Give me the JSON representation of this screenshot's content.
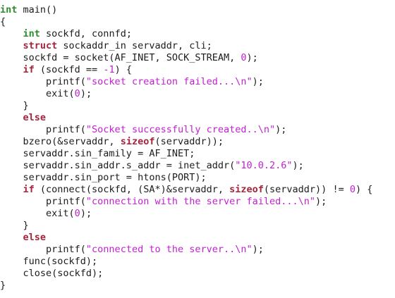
{
  "editor": {
    "colors": {
      "background": "#ffffff",
      "text": "#1c1c1c",
      "type_keyword": "#2e8b2e",
      "control_keyword": "#a5243c",
      "string_literal": "#c21fd0",
      "number_literal": "#c21fd0"
    },
    "lines": [
      [
        {
          "k": "kw-type",
          "t": "int"
        },
        {
          "k": "plain",
          "t": " main()"
        }
      ],
      [
        {
          "k": "plain",
          "t": "{"
        }
      ],
      [
        {
          "k": "plain",
          "t": "    "
        },
        {
          "k": "kw-type",
          "t": "int"
        },
        {
          "k": "plain",
          "t": " sockfd, connfd;"
        }
      ],
      [
        {
          "k": "plain",
          "t": "    "
        },
        {
          "k": "kw-ctrl",
          "t": "struct"
        },
        {
          "k": "plain",
          "t": " sockaddr_in servaddr, cli;"
        }
      ],
      [
        {
          "k": "plain",
          "t": "    sockfd = socket(AF_INET, SOCK_STREAM, "
        },
        {
          "k": "num",
          "t": "0"
        },
        {
          "k": "plain",
          "t": ");"
        }
      ],
      [
        {
          "k": "plain",
          "t": "    "
        },
        {
          "k": "kw-ctrl",
          "t": "if"
        },
        {
          "k": "plain",
          "t": " (sockfd == "
        },
        {
          "k": "num",
          "t": "-1"
        },
        {
          "k": "plain",
          "t": ") {"
        }
      ],
      [
        {
          "k": "plain",
          "t": "        printf("
        },
        {
          "k": "str",
          "t": "\"socket creation failed...\\n\""
        },
        {
          "k": "plain",
          "t": ");"
        }
      ],
      [
        {
          "k": "plain",
          "t": "        exit("
        },
        {
          "k": "num",
          "t": "0"
        },
        {
          "k": "plain",
          "t": ");"
        }
      ],
      [
        {
          "k": "plain",
          "t": "    }"
        }
      ],
      [
        {
          "k": "plain",
          "t": "    "
        },
        {
          "k": "kw-ctrl",
          "t": "else"
        }
      ],
      [
        {
          "k": "plain",
          "t": "        printf("
        },
        {
          "k": "str",
          "t": "\"Socket successfully created..\\n\""
        },
        {
          "k": "plain",
          "t": ");"
        }
      ],
      [
        {
          "k": "plain",
          "t": "    bzero(&servaddr, "
        },
        {
          "k": "kw-ctrl",
          "t": "sizeof"
        },
        {
          "k": "plain",
          "t": "(servaddr));"
        }
      ],
      [
        {
          "k": "plain",
          "t": "    servaddr.sin_family = AF_INET;"
        }
      ],
      [
        {
          "k": "plain",
          "t": "    servaddr.sin_addr.s_addr = inet_addr("
        },
        {
          "k": "str",
          "t": "\"10.0.2.6\""
        },
        {
          "k": "plain",
          "t": ");"
        }
      ],
      [
        {
          "k": "plain",
          "t": "    servaddr.sin_port = htons(PORT);"
        }
      ],
      [
        {
          "k": "plain",
          "t": "    "
        },
        {
          "k": "kw-ctrl",
          "t": "if"
        },
        {
          "k": "plain",
          "t": " (connect(sockfd, (SA*)&servaddr, "
        },
        {
          "k": "kw-ctrl",
          "t": "sizeof"
        },
        {
          "k": "plain",
          "t": "(servaddr)) != "
        },
        {
          "k": "num",
          "t": "0"
        },
        {
          "k": "plain",
          "t": ") {"
        }
      ],
      [
        {
          "k": "plain",
          "t": "        printf("
        },
        {
          "k": "str",
          "t": "\"connection with the server failed...\\n\""
        },
        {
          "k": "plain",
          "t": ");"
        }
      ],
      [
        {
          "k": "plain",
          "t": "        exit("
        },
        {
          "k": "num",
          "t": "0"
        },
        {
          "k": "plain",
          "t": ");"
        }
      ],
      [
        {
          "k": "plain",
          "t": "    }"
        }
      ],
      [
        {
          "k": "plain",
          "t": "    "
        },
        {
          "k": "kw-ctrl",
          "t": "else"
        }
      ],
      [
        {
          "k": "plain",
          "t": "        printf("
        },
        {
          "k": "str",
          "t": "\"connected to the server..\\n\""
        },
        {
          "k": "plain",
          "t": ");"
        }
      ],
      [
        {
          "k": "plain",
          "t": "    func(sockfd);"
        }
      ],
      [
        {
          "k": "plain",
          "t": "    close(sockfd);"
        }
      ],
      [
        {
          "k": "plain",
          "t": "}"
        }
      ]
    ]
  }
}
